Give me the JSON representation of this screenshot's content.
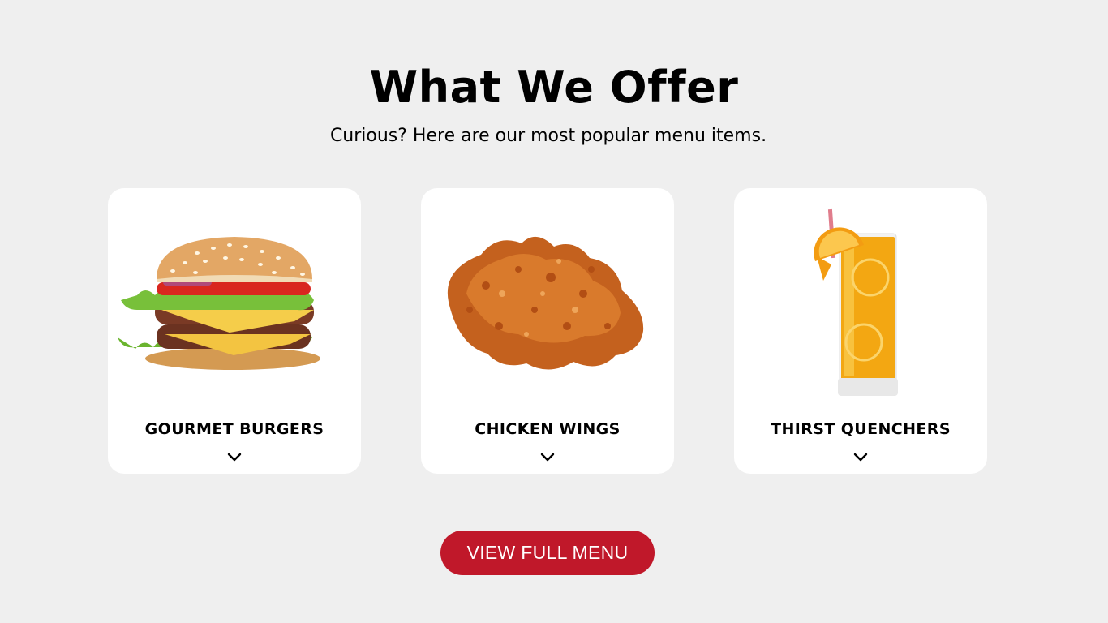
{
  "section": {
    "title": "What We Offer",
    "subtitle": "Curious? Here are our most popular menu items."
  },
  "cards": [
    {
      "title": "GOURMET BURGERS",
      "image": "burger-image",
      "icon": "chevron-down-icon"
    },
    {
      "title": "CHICKEN WINGS",
      "image": "fried-chicken-image",
      "icon": "chevron-down-icon"
    },
    {
      "title": "THIRST QUENCHERS",
      "image": "orange-drink-image",
      "icon": "chevron-down-icon"
    }
  ],
  "cta": {
    "label": "VIEW FULL MENU"
  },
  "colors": {
    "background": "#efefef",
    "card": "#ffffff",
    "accent": "#c0182a"
  }
}
